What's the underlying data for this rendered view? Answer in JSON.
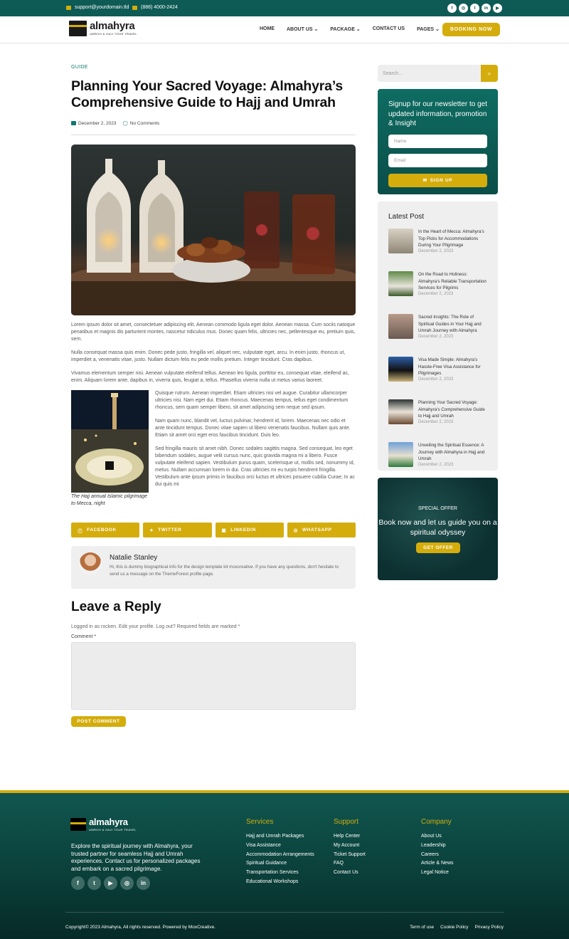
{
  "topbar": {
    "email": "support@yourdomain.tld",
    "phone": "(888) 4000-2424",
    "social_icons": [
      "facebook-icon",
      "instagram-icon",
      "twitter-icon",
      "linkedin-icon",
      "youtube-icon"
    ]
  },
  "brand": {
    "name": "almahyra",
    "tagline": "UMROH & HAJI TOUR TRAVEL"
  },
  "nav": {
    "items": [
      "HOME",
      "ABOUT US",
      "PACKAGE",
      "CONTACT US",
      "PAGES"
    ],
    "book_label": "BOOKING NOW"
  },
  "post": {
    "category": "GUIDE",
    "title": "Planning Your Sacred Voyage: Almahyra’s Comprehensive Guide to Hajj and Umrah",
    "date": "December 2, 2023",
    "comments": "No Comments",
    "paragraphs": [
      "Lorem ipsum dolor sit amet, consectetuer adipiscing elit. Aenean commodo ligula eget dolor. Aenean massa. Cum sociis natoque penatibus et magnis dis parturient montes, nascetur ridiculus mus. Donec quam felis, ultricies nec, pellentesque eu, pretium quis, sem.",
      "Nulla consequat massa quis enim. Donec pede justo, fringilla vel, aliquet nec, vulputate eget, arcu. In enim justo, rhoncus ut, imperdiet a, venenatis vitae, justo. Nullam dictum felis eu pede mollis pretium. Integer tincidunt. Cras dapibus.",
      "Vivamus elementum semper nisi. Aenean vulputate eleifend tellus. Aenean leo ligula, porttitor eu, consequat vitae, eleifend ac, enim. Aliquam lorem ante, dapibus in, viverra quis, feugiat a, tellus. Phasellus viverra nulla ut metus varius laoreet."
    ],
    "float_paragraphs": [
      "Quisque rutrum. Aenean imperdiet. Etiam ultricies nisi vel augue. Curabitur ullamcorper ultricies nisi. Nam eget dui. Etiam rhoncus. Maecenas tempus, tellus eget condimentum rhoncus, sem quam semper libero, sit amet adipiscing sem neque sed ipsum.",
      "Nam quam nunc, blandit vel, luctus pulvinar, hendrerit id, lorem. Maecenas nec odio et ante tincidunt tempus. Donec vitae sapien ut libero venenatis faucibus. Nullam quis ante. Etiam sit amet orci eget eros faucibus tincidunt. Duis leo.",
      "Sed fringilla mauris sit amet nibh. Donec sodales sagittis magna. Sed consequat, leo eget bibendum sodales, augue velit cursus nunc, quis gravida magna mi a libero. Fusce vulputate eleifend sapien. Vestibulum purus quam, scelerisque ut, mollis sed, nonummy id, metus. Nullam accumsan lorem in dui. Cras ultricies mi eu turpis hendrerit fringilla. Vestibulum ante ipsum primis in faucibus orci luctus et ultrices posuere cubilia Curae; In ac dui quis mi"
    ],
    "image_caption": "The Hajj annual Islamic pilgrimage to Mecca, night",
    "share": [
      "FACEBOOK",
      "TWITTER",
      "LINKEDIN",
      "WHATSAPP"
    ],
    "author": {
      "name": "Natalie Stanley",
      "bio": "Hi, this is dummy biographical info for the design template kit moxcreative. If you have any questions, don't hesitate to send us a message on the ThemeForest profile page."
    }
  },
  "reply": {
    "heading": "Leave a Reply",
    "logged_in": "Logged in as rocken. Edit your profile. Log out? Required fields are marked *",
    "comment_label": "Comment *",
    "submit": "POST COMMENT"
  },
  "sidebar": {
    "search_placeholder": "Search...",
    "newsletter": {
      "heading": "Signup for our newsletter to get updated information, promotion & Insight",
      "name_placeholder": "Name",
      "email_placeholder": "Email",
      "button": "SIGN UP"
    },
    "latest": {
      "heading": "Latest Post",
      "posts": [
        {
          "title": "In the Heart of Mecca: Almahyra’s Top Picks for Accommodations During Your Pilgrimage",
          "date": "December 2, 2023"
        },
        {
          "title": "On the Road to Holiness: Almahyra’s Reliable Transportation Services for Pilgrims",
          "date": "December 2, 2023"
        },
        {
          "title": "Sacred Insights: The Role of Spiritual Guides in Your Hajj and Umrah Journey with Almahyra",
          "date": "December 2, 2023"
        },
        {
          "title": "Visa Made Simple: Almahyra’s Hassle-Free Visa Assistance for Pilgrimages",
          "date": "December 2, 2023"
        },
        {
          "title": "Planning Your Sacred Voyage: Almahyra’s Comprehensive Guide to Hajj and Umrah",
          "date": "December 2, 2023"
        },
        {
          "title": "Unveiling the Spiritual Essence: A Journey with Almahyra in Hajj and Umrah",
          "date": "December 2, 2023"
        }
      ]
    },
    "offer": {
      "tag": "SPECIAL OFFER",
      "heading": "Book now and let us guide you on a spiritual odyssey",
      "button": "GET OFFER"
    }
  },
  "footer": {
    "about": "Explore the spiritual journey with Almahyra, your trusted partner for seamless Hajj and Umrah experiences. Contact us for personalized packages and embark on a sacred pilgrimage.",
    "social_icons": [
      "facebook-icon",
      "twitter-icon",
      "youtube-icon",
      "instagram-icon",
      "linkedin-icon"
    ],
    "services": {
      "heading": "Services",
      "items": [
        "Hajj and Umrah Packages",
        "Visa Assistance",
        "Accommodation Arrangements",
        "Spiritual Guidance",
        "Transportation Services",
        "Educational Workshops"
      ]
    },
    "support": {
      "heading": "Support",
      "items": [
        "Help Center",
        "My Account",
        "Ticket Support",
        "FAQ",
        "Contact Us"
      ]
    },
    "company": {
      "heading": "Company",
      "items": [
        "About Us",
        "Leadership",
        "Careers",
        "Article & News",
        "Legal Notice"
      ]
    },
    "copyright": "Copyright© 2023 Almahyra, All rights reserved. Powered by MoxCreative.",
    "links": [
      "Term of use",
      "Cookie Policy",
      "Privacy Policy"
    ]
  },
  "colors": {
    "primary": "#0e5a55",
    "accent": "#d4ad0c"
  }
}
